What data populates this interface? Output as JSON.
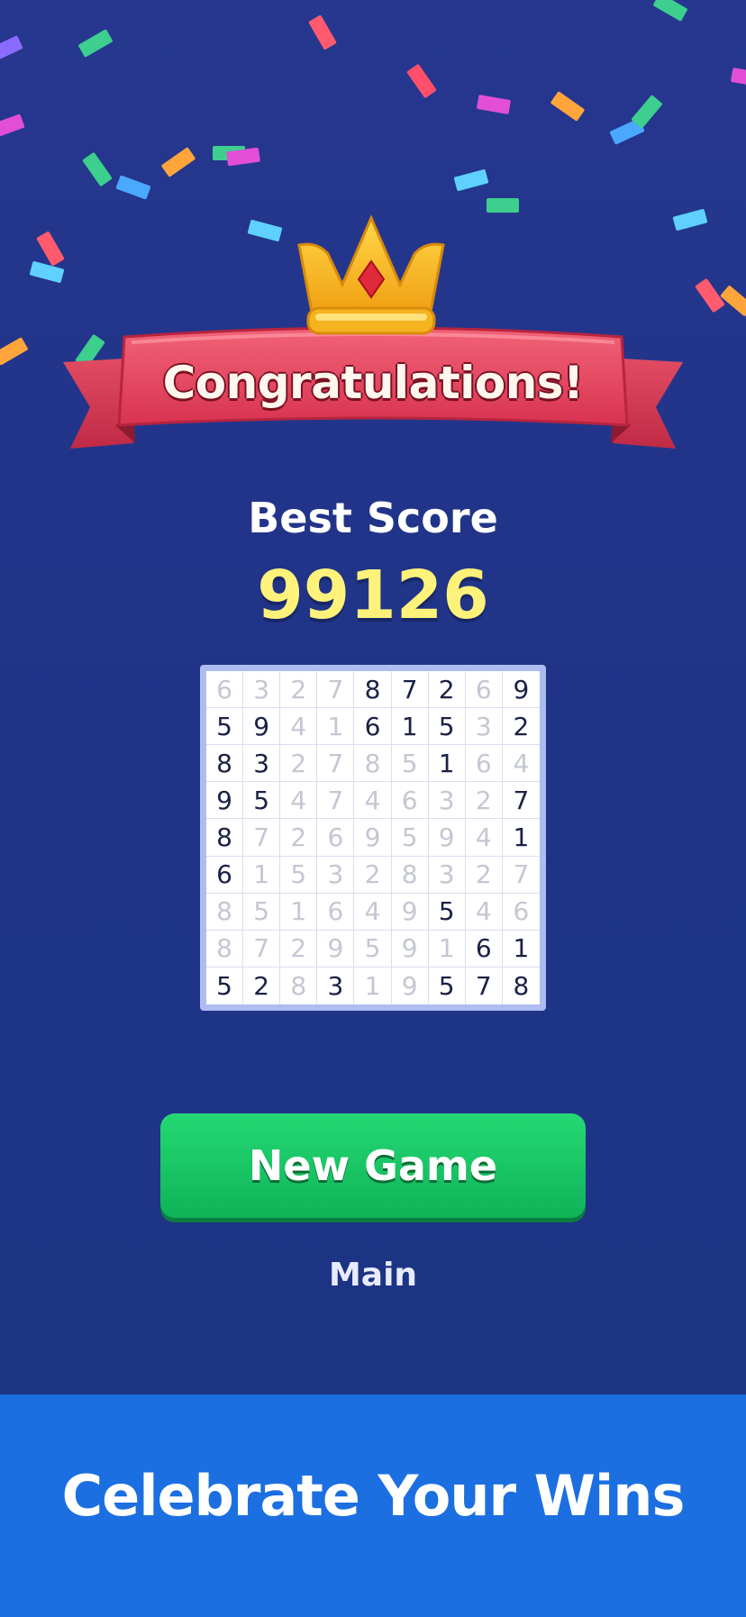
{
  "header": {
    "title": "Congratulations!"
  },
  "score": {
    "label": "Best Score",
    "value": "99126"
  },
  "board": {
    "rows": [
      [
        {
          "v": "6",
          "g": false
        },
        {
          "v": "3",
          "g": false
        },
        {
          "v": "2",
          "g": false
        },
        {
          "v": "7",
          "g": false
        },
        {
          "v": "8",
          "g": true
        },
        {
          "v": "7",
          "g": true
        },
        {
          "v": "2",
          "g": true
        },
        {
          "v": "6",
          "g": false
        },
        {
          "v": "9",
          "g": true
        }
      ],
      [
        {
          "v": "5",
          "g": true
        },
        {
          "v": "9",
          "g": true
        },
        {
          "v": "4",
          "g": false
        },
        {
          "v": "1",
          "g": false
        },
        {
          "v": "6",
          "g": true
        },
        {
          "v": "1",
          "g": true
        },
        {
          "v": "5",
          "g": true
        },
        {
          "v": "3",
          "g": false
        },
        {
          "v": "2",
          "g": true
        }
      ],
      [
        {
          "v": "8",
          "g": true
        },
        {
          "v": "3",
          "g": true
        },
        {
          "v": "2",
          "g": false
        },
        {
          "v": "7",
          "g": false
        },
        {
          "v": "8",
          "g": false
        },
        {
          "v": "5",
          "g": false
        },
        {
          "v": "1",
          "g": true
        },
        {
          "v": "6",
          "g": false
        },
        {
          "v": "4",
          "g": false
        }
      ],
      [
        {
          "v": "9",
          "g": true
        },
        {
          "v": "5",
          "g": true
        },
        {
          "v": "4",
          "g": false
        },
        {
          "v": "7",
          "g": false
        },
        {
          "v": "4",
          "g": false
        },
        {
          "v": "6",
          "g": false
        },
        {
          "v": "3",
          "g": false
        },
        {
          "v": "2",
          "g": false
        },
        {
          "v": "7",
          "g": true
        }
      ],
      [
        {
          "v": "8",
          "g": true
        },
        {
          "v": "7",
          "g": false
        },
        {
          "v": "2",
          "g": false
        },
        {
          "v": "6",
          "g": false
        },
        {
          "v": "9",
          "g": false
        },
        {
          "v": "5",
          "g": false
        },
        {
          "v": "9",
          "g": false
        },
        {
          "v": "4",
          "g": false
        },
        {
          "v": "1",
          "g": true
        }
      ],
      [
        {
          "v": "6",
          "g": true
        },
        {
          "v": "1",
          "g": false
        },
        {
          "v": "5",
          "g": false
        },
        {
          "v": "3",
          "g": false
        },
        {
          "v": "2",
          "g": false
        },
        {
          "v": "8",
          "g": false
        },
        {
          "v": "3",
          "g": false
        },
        {
          "v": "2",
          "g": false
        },
        {
          "v": "7",
          "g": false
        }
      ],
      [
        {
          "v": "8",
          "g": false
        },
        {
          "v": "5",
          "g": false
        },
        {
          "v": "1",
          "g": false
        },
        {
          "v": "6",
          "g": false
        },
        {
          "v": "4",
          "g": false
        },
        {
          "v": "9",
          "g": false
        },
        {
          "v": "5",
          "g": true
        },
        {
          "v": "4",
          "g": false
        },
        {
          "v": "6",
          "g": false
        }
      ],
      [
        {
          "v": "8",
          "g": false
        },
        {
          "v": "7",
          "g": false
        },
        {
          "v": "2",
          "g": false
        },
        {
          "v": "9",
          "g": false
        },
        {
          "v": "5",
          "g": false
        },
        {
          "v": "9",
          "g": false
        },
        {
          "v": "1",
          "g": false
        },
        {
          "v": "6",
          "g": true
        },
        {
          "v": "1",
          "g": true
        }
      ],
      [
        {
          "v": "5",
          "g": true
        },
        {
          "v": "2",
          "g": true
        },
        {
          "v": "8",
          "g": false
        },
        {
          "v": "3",
          "g": true
        },
        {
          "v": "1",
          "g": false
        },
        {
          "v": "9",
          "g": false
        },
        {
          "v": "5",
          "g": true
        },
        {
          "v": "7",
          "g": true
        },
        {
          "v": "8",
          "g": true
        }
      ]
    ]
  },
  "actions": {
    "new_game_label": "New Game",
    "main_label": "Main"
  },
  "banner": {
    "text": "Celebrate Your Wins"
  },
  "colors": {
    "background": "#27378f",
    "score_yellow": "#fff27a",
    "button_green": "#1fc868",
    "ribbon_red": "#e8475e",
    "banner_blue": "#1b6fe0"
  },
  "icons": {
    "crown": "crown-icon"
  }
}
